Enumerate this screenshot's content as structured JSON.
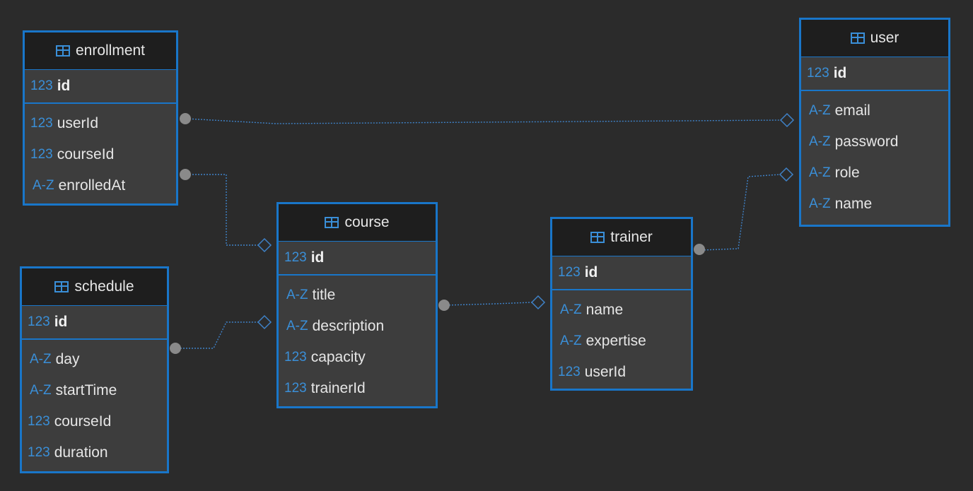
{
  "colors": {
    "background": "#2b2b2b",
    "entity_fill": "#3d3d3d",
    "header_fill": "#1e1e1e",
    "border": "#1976c9",
    "type_icon": "#3a8fd8",
    "edge": "#3f82c8",
    "dot": "#8a8a8a"
  },
  "type_labels": {
    "numeric": "123",
    "text": "A-Z"
  },
  "entities": {
    "enrollment": {
      "name": "enrollment",
      "icon": "table-icon",
      "pk": {
        "name": "id",
        "type": "numeric"
      },
      "columns": [
        {
          "name": "userId",
          "type": "numeric"
        },
        {
          "name": "courseId",
          "type": "numeric"
        },
        {
          "name": "enrolledAt",
          "type": "text"
        }
      ]
    },
    "user": {
      "name": "user",
      "icon": "table-icon",
      "pk": {
        "name": "id",
        "type": "numeric"
      },
      "columns": [
        {
          "name": "email",
          "type": "text"
        },
        {
          "name": "password",
          "type": "text"
        },
        {
          "name": "role",
          "type": "text"
        },
        {
          "name": "name",
          "type": "text"
        }
      ]
    },
    "course": {
      "name": "course",
      "icon": "table-icon",
      "pk": {
        "name": "id",
        "type": "numeric"
      },
      "columns": [
        {
          "name": "title",
          "type": "text"
        },
        {
          "name": "description",
          "type": "text"
        },
        {
          "name": "capacity",
          "type": "numeric"
        },
        {
          "name": "trainerId",
          "type": "numeric"
        }
      ]
    },
    "trainer": {
      "name": "trainer",
      "icon": "table-icon",
      "pk": {
        "name": "id",
        "type": "numeric"
      },
      "columns": [
        {
          "name": "name",
          "type": "text"
        },
        {
          "name": "expertise",
          "type": "text"
        },
        {
          "name": "userId",
          "type": "numeric"
        }
      ]
    },
    "schedule": {
      "name": "schedule",
      "icon": "table-icon",
      "pk": {
        "name": "id",
        "type": "numeric"
      },
      "columns": [
        {
          "name": "day",
          "type": "text"
        },
        {
          "name": "startTime",
          "type": "text"
        },
        {
          "name": "courseId",
          "type": "numeric"
        },
        {
          "name": "duration",
          "type": "numeric"
        }
      ]
    }
  },
  "relationships": [
    {
      "from": "enrollment.userId",
      "to": "user"
    },
    {
      "from": "enrollment.courseId",
      "to": "course"
    },
    {
      "from": "schedule.courseId",
      "to": "course"
    },
    {
      "from": "course.trainerId",
      "to": "trainer"
    },
    {
      "from": "trainer.userId",
      "to": "user"
    }
  ]
}
